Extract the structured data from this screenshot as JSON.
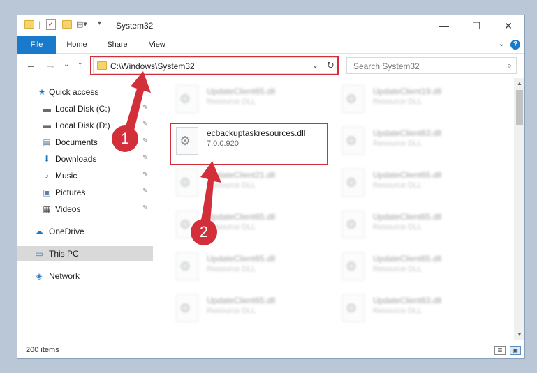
{
  "window": {
    "title": "System32",
    "controls": {
      "minimize": "—",
      "maximize": "☐",
      "close": "✕"
    }
  },
  "ribbon": {
    "tabs": [
      "File",
      "Home",
      "Share",
      "View"
    ],
    "help": "?",
    "expand": "⌄"
  },
  "nav": {
    "back": "←",
    "forward": "→",
    "recent": "⌄",
    "up": "↑",
    "address": "C:\\Windows\\System32",
    "address_chevron": "⌄",
    "refresh": "↻",
    "search_placeholder": "Search System32",
    "search_icon": "⌕"
  },
  "sidebar": {
    "items": [
      {
        "label": "Quick access",
        "icon": "star-icon",
        "glyph": "★"
      },
      {
        "label": "Local Disk (C:)",
        "icon": "drive-icon",
        "glyph": "▬"
      },
      {
        "label": "Local Disk (D:)",
        "icon": "drive-icon",
        "glyph": "▬"
      },
      {
        "label": "Documents",
        "icon": "documents-icon",
        "glyph": "▤"
      },
      {
        "label": "Downloads",
        "icon": "downloads-icon",
        "glyph": "⬇"
      },
      {
        "label": "Music",
        "icon": "music-icon",
        "glyph": "♪"
      },
      {
        "label": "Pictures",
        "icon": "pictures-icon",
        "glyph": "▣"
      },
      {
        "label": "Videos",
        "icon": "videos-icon",
        "glyph": "▦"
      },
      {
        "label": "OneDrive",
        "icon": "cloud-icon",
        "glyph": "☁"
      },
      {
        "label": "This PC",
        "icon": "computer-icon",
        "glyph": "▭"
      },
      {
        "label": "Network",
        "icon": "network-icon",
        "glyph": "◈"
      }
    ],
    "pin_glyph": "✎"
  },
  "files": [
    {
      "name": "UpdateClient65.dll",
      "sub": "Resource DLL"
    },
    {
      "name": "UpdateClient19.dll",
      "sub": "Resource DLL"
    },
    {
      "name": "ecbackuptaskresources.dll",
      "sub": "7.0.0.920"
    },
    {
      "name": "UpdateClient63.dll",
      "sub": "Resource DLL"
    },
    {
      "name": "UpdateClient21.dll",
      "sub": "Resource DLL"
    },
    {
      "name": "UpdateClient65.dll",
      "sub": "Resource DLL"
    },
    {
      "name": "UpdateClient65.dll",
      "sub": "Resource DLL"
    },
    {
      "name": "UpdateClient65.dll",
      "sub": "Resource DLL"
    },
    {
      "name": "UpdateClient65.dll",
      "sub": "Resource DLL"
    },
    {
      "name": "UpdateClient65.dll",
      "sub": "Resource DLL"
    },
    {
      "name": "UpdateClient65.dll",
      "sub": "Resource DLL"
    },
    {
      "name": "UpdateClient63.dll",
      "sub": "Resource DLL"
    }
  ],
  "status": {
    "count": "200 items"
  },
  "markers": {
    "one": "1",
    "two": "2"
  },
  "colors": {
    "accent": "#1979ca",
    "highlight": "#d32f3b"
  }
}
